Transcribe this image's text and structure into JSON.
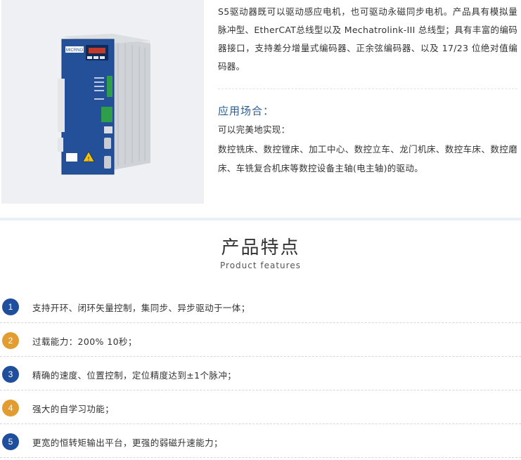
{
  "intro": {
    "text": "S5驱动器既可以驱动感应电机，也可驱动永磁同步电机。产品具有模拟量脉冲型、EtherCAT总线型以及 Mechatrolink-III 总线型；具有丰富的编码器接口，支持差分增量式编码器、正余弦编码器、以及 17/23 位绝对值编码器。"
  },
  "application": {
    "heading": "应用场合：",
    "subheading": "可以完美地实现：",
    "body": "数控铣床、数控镗床、加工中心、数控立车、龙门机床、数控车床、数控磨床、车铣复合机床等数控设备主轴(电主轴)的驱动。"
  },
  "product_image": {
    "brand": "MICRNO",
    "display": "88888"
  },
  "features_section": {
    "title": "产品特点",
    "subtitle": "Product features"
  },
  "features": [
    {
      "num": "1",
      "text": "支持开环、闭环矢量控制，集同步、异步驱动于一体；",
      "color": "#1f4e9c"
    },
    {
      "num": "2",
      "text": "过载能力：200% 10秒；",
      "color": "#e39c2f"
    },
    {
      "num": "3",
      "text": "精确的速度、位置控制，定位精度达到±1个脉冲；",
      "color": "#1f4e9c"
    },
    {
      "num": "4",
      "text": "强大的自学习功能；",
      "color": "#e39c2f"
    },
    {
      "num": "5",
      "text": "更宽的恒转矩输出平台，更强的弱磁升速能力；",
      "color": "#1f4e9c"
    }
  ]
}
